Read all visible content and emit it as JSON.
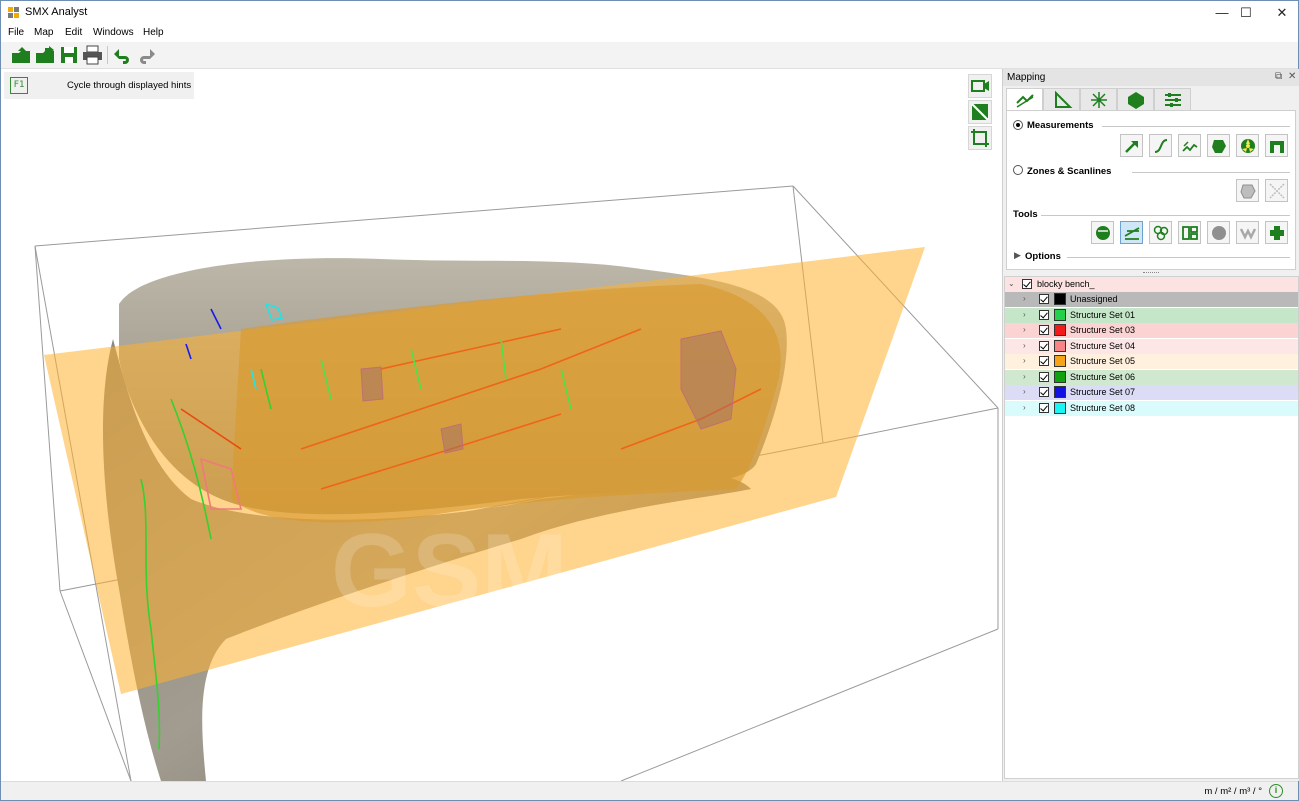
{
  "window": {
    "title": "SMX Analyst",
    "minimize": "—",
    "maximize": "☐",
    "close": "✕"
  },
  "menu": [
    "File",
    "Map",
    "Edit",
    "Windows",
    "Help"
  ],
  "toolbar": {
    "buttons": [
      "open-project-icon",
      "import-icon",
      "save-icon",
      "print-icon",
      "undo-icon",
      "redo-icon"
    ]
  },
  "hint": {
    "key": "F1",
    "text": "Cycle through displayed hints"
  },
  "viewport_buttons": [
    "camera-icon",
    "view-toggle-icon",
    "crop-view-icon"
  ],
  "watermark": "GSM",
  "mapping_panel": {
    "title": "Mapping",
    "tabs": [
      "measure-tab-icon",
      "angle-tab-icon",
      "zones-tab-icon",
      "polygon-tab-icon",
      "settings-tab-icon"
    ],
    "measurements": {
      "label": "Measurements",
      "selected": true,
      "tools": [
        "arrow-tool-icon",
        "curve-tool-icon",
        "multi-trace-icon",
        "plane-tool-icon",
        "radiation-tool-icon",
        "arch-tool-icon"
      ]
    },
    "zones": {
      "label": "Zones & Scanlines",
      "selected": false,
      "tools": [
        "zone-polygon-icon",
        "scanline-icon"
      ]
    },
    "tools": {
      "label": "Tools",
      "items": [
        "globe-tool-icon",
        "layers-tool-icon",
        "cluster-tool-icon",
        "panels-tool-icon",
        "sphere-tool-icon",
        "wave-tool-icon",
        "add-tool-icon"
      ]
    },
    "options_label": "Options"
  },
  "tree": {
    "root": "blocky bench_",
    "root_color": "#fde2e2",
    "items": [
      {
        "label": "Unassigned",
        "swatch": "#000000",
        "row": "#b9b9b9"
      },
      {
        "label": "Structure Set 01",
        "swatch": "#22d04a",
        "row": "#c6e6c9"
      },
      {
        "label": "Structure Set 03",
        "swatch": "#f21b1b",
        "row": "#fbd3d3"
      },
      {
        "label": "Structure Set 04",
        "swatch": "#f78585",
        "row": "#fde6e6"
      },
      {
        "label": "Structure Set 05",
        "swatch": "#f7a318",
        "row": "#fff1de"
      },
      {
        "label": "Structure Set 06",
        "swatch": "#0ea30e",
        "row": "#cfe8cf"
      },
      {
        "label": "Structure Set 07",
        "swatch": "#1111e6",
        "row": "#dcdcf7"
      },
      {
        "label": "Structure Set 08",
        "swatch": "#19f5f5",
        "row": "#d9fbfb"
      }
    ]
  },
  "status": {
    "units": "m / m² / m³ / °"
  }
}
